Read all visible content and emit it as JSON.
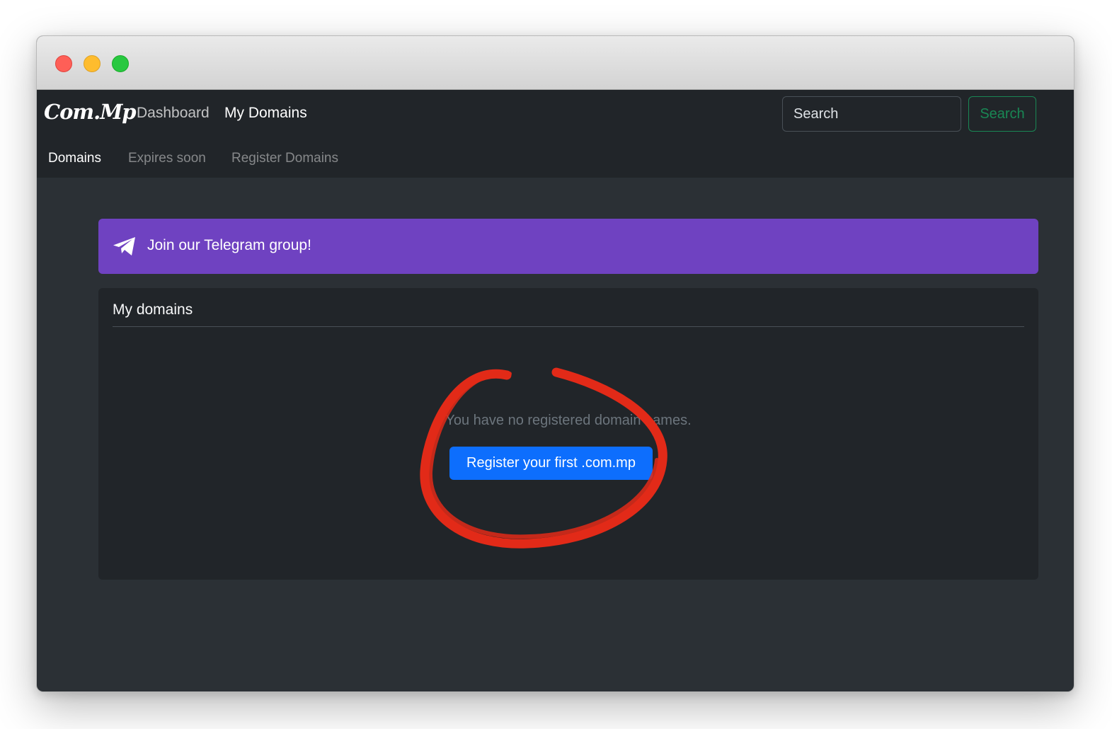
{
  "navbar": {
    "brand": "Com.Mp",
    "links": [
      "Dashboard",
      "My Domains"
    ],
    "active_link": "My Domains",
    "search_placeholder": "Search",
    "search_button": "Search"
  },
  "subnav": {
    "links": [
      "Domains",
      "Expires soon",
      "Register Domains"
    ],
    "active_link": "Domains"
  },
  "banner": {
    "text": "Join our Telegram group!",
    "icon": "telegram-icon",
    "color": "#6f42c1"
  },
  "card": {
    "title": "My domains",
    "empty_message": "You have no registered domain names.",
    "register_button": "Register your first .com.mp"
  },
  "colors": {
    "primary": "#0d6efd",
    "success": "#198754",
    "annotation": "#e22a18"
  }
}
